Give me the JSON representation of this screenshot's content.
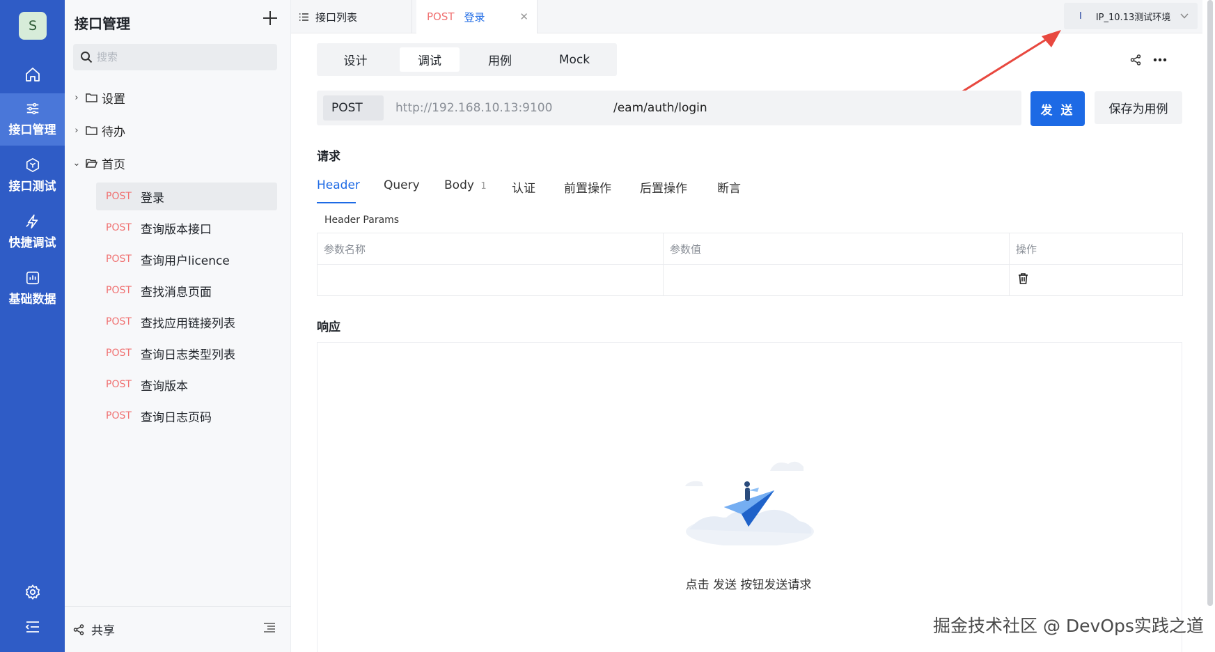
{
  "app": {
    "user_initial": "S",
    "accent_color": "#2f5cc6",
    "primary_button_color": "#1d6ae5",
    "method_color": "#f07070"
  },
  "rail": {
    "items": [
      {
        "icon": "home-icon",
        "label": ""
      },
      {
        "icon": "sliders-icon",
        "label": "接口管理"
      },
      {
        "icon": "cube-icon",
        "label": "接口测试"
      },
      {
        "icon": "lightning-icon",
        "label": "快捷调试"
      },
      {
        "icon": "chart-icon",
        "label": "基础数据"
      }
    ],
    "bottom": [
      {
        "icon": "settings-gear-icon"
      },
      {
        "icon": "collapse-menu-icon"
      }
    ]
  },
  "tree": {
    "title": "接口管理",
    "add_icon": "plus-icon",
    "search_placeholder": "搜索",
    "folders": [
      {
        "label": "设置",
        "expanded": false
      },
      {
        "label": "待办",
        "expanded": false
      },
      {
        "label": "首页",
        "expanded": true
      }
    ],
    "apis": [
      {
        "method": "POST",
        "name": "登录",
        "active": true
      },
      {
        "method": "POST",
        "name": "查询版本接口",
        "active": false
      },
      {
        "method": "POST",
        "name": "查询用户licence",
        "active": false
      },
      {
        "method": "POST",
        "name": "查找消息页面",
        "active": false
      },
      {
        "method": "POST",
        "name": "查找应用链接列表",
        "active": false
      },
      {
        "method": "POST",
        "name": "查询日志类型列表",
        "active": false
      },
      {
        "method": "POST",
        "name": "查询版本",
        "active": false
      },
      {
        "method": "POST",
        "name": "查询日志页码",
        "active": false
      }
    ],
    "footer_label": "共享"
  },
  "tabs": [
    {
      "label": "接口列表",
      "method": "",
      "icon": "list-icon"
    },
    {
      "label": "登录",
      "method": "POST",
      "icon": "close-icon"
    }
  ],
  "environment": {
    "marker": "I",
    "label": "IP_10.13测试环境"
  },
  "modes": [
    "设计",
    "调试",
    "用例",
    "Mock"
  ],
  "active_mode": "调试",
  "request_bar": {
    "method": "POST",
    "host": "http://192.168.10.13:9100",
    "path": "/eam/auth/login",
    "send_label": "发 送",
    "save_label": "保存为用例"
  },
  "request": {
    "section_title": "请求",
    "tabs": [
      {
        "label": "Header",
        "count": ""
      },
      {
        "label": "Query",
        "count": ""
      },
      {
        "label": "Body",
        "count": "1"
      },
      {
        "label": "认证",
        "count": ""
      },
      {
        "label": "前置操作",
        "count": ""
      },
      {
        "label": "后置操作",
        "count": ""
      },
      {
        "label": "断言",
        "count": ""
      }
    ],
    "active_tab": "Header",
    "params_title": "Header Params",
    "columns": [
      "参数名称",
      "参数值",
      "操作"
    ]
  },
  "response": {
    "section_title": "响应",
    "empty_text": "点击 发送 按钮发送请求"
  },
  "watermark": "掘金技术社区 @ DevOps实践之道"
}
